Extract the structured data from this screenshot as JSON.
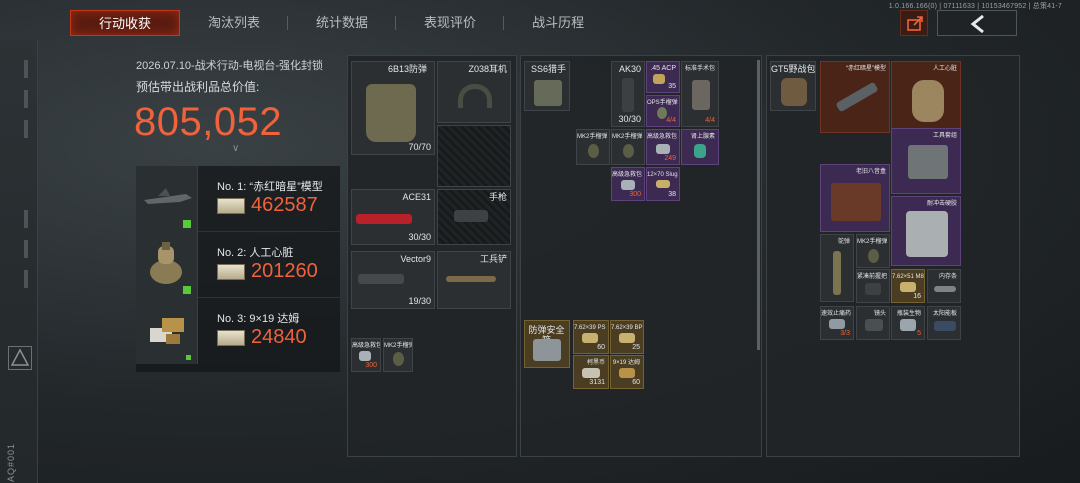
{
  "nav": {
    "tabs": [
      {
        "label": "行动收获",
        "active": true
      },
      {
        "label": "淘汰列表"
      },
      {
        "label": "统计数据"
      },
      {
        "label": "表现评价"
      },
      {
        "label": "战斗历程"
      }
    ]
  },
  "version_text": "1.0.166.166(0) | 07111633 | 10153467952 | 总策41-7",
  "rail_code": "AQ#001",
  "summary": {
    "subtitle": "2026.07.10-战术行动-电视台-强化封锁",
    "value_label": "预估带出战利品总价值:",
    "total": "805,052"
  },
  "top_items": [
    {
      "rank": "No. 1: “赤红暗星”模型",
      "value": "462587"
    },
    {
      "rank": "No. 2: 人工心脏",
      "value": "201260"
    },
    {
      "rank": "No. 3: 9×19 达姆",
      "value": "24840"
    }
  ],
  "loadout": {
    "armor": {
      "name": "6B13防弹",
      "count": "70/70"
    },
    "headset": {
      "name": "Z038耳机"
    },
    "primary": {
      "name": "ACE31",
      "count": "30/30"
    },
    "pistol": {
      "name": "手枪"
    },
    "secondary": {
      "name": "Vector9",
      "count": "19/30"
    },
    "melee": {
      "name": "工兵铲"
    },
    "pocket": [
      {
        "name": "高级急救包",
        "count": "300"
      },
      {
        "name": "MK2手榴弹"
      }
    ]
  },
  "rig": {
    "rig_name": "SS6猎手",
    "items": [
      {
        "name": "AK30",
        "count": "30/30"
      },
      {
        "name": ".45 ACP",
        "count": "35"
      },
      {
        "name": "标准手术包",
        "count": "4/4"
      },
      {
        "name": "OPS手榴弹",
        "count": "4/4"
      },
      {
        "name": "MK2手榴弹"
      },
      {
        "name": "MK2手榴弹"
      },
      {
        "name": "高级急救包",
        "count": "249"
      },
      {
        "name": "肾上腺素"
      },
      {
        "name": "高级急救包",
        "count": "300"
      },
      {
        "name": "12×70 Slug",
        "count": "38"
      }
    ],
    "safe_box": {
      "name": "防弹安全箱"
    },
    "safe_items": [
      {
        "name": "7.62×39 PS",
        "count": "60"
      },
      {
        "name": "7.62×39 BP",
        "count": "25"
      },
      {
        "name": "柯黑币",
        "count": "3131"
      },
      {
        "name": "9×19 达姆",
        "count": "60"
      }
    ]
  },
  "backpack": {
    "name": "GT5野战包",
    "items": [
      {
        "name": "“赤红暗星”模型"
      },
      {
        "name": "人工心脏"
      },
      {
        "name": "工具套组"
      },
      {
        "name": "老旧八音盒"
      },
      {
        "name": "耐冲击硬胶"
      },
      {
        "name": "鸵弹"
      },
      {
        "name": "MK2手榴弹"
      },
      {
        "name": "紧凑前握把"
      },
      {
        "name": "7.62×51 M80",
        "count": "16"
      },
      {
        "name": "内存条"
      },
      {
        "name": "速效止痛药",
        "count": "3/3"
      },
      {
        "name": "镜头"
      },
      {
        "name": "瓶装生物",
        "count": "5"
      },
      {
        "name": "太阳能板"
      }
    ]
  },
  "colors": {
    "accent": "#f0623a",
    "active_tab": "#c2391a",
    "purple_tier": "#3c2a52",
    "gold_tier": "#4a3d22",
    "red_tier": "#4b2418"
  },
  "icons": {
    "export": "share-icon",
    "back": "chevron-left-icon"
  }
}
